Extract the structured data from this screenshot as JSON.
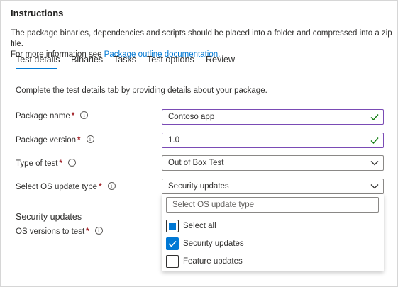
{
  "title": "Instructions",
  "description": {
    "line1": "The package binaries, dependencies and scripts should be placed into a folder and compressed into a zip file.",
    "line2_prefix": "For more information see ",
    "link": "Package outline documentation."
  },
  "tabs": [
    {
      "label": "Test details",
      "active": true
    },
    {
      "label": "Binaries"
    },
    {
      "label": "Tasks"
    },
    {
      "label": "Test options"
    },
    {
      "label": "Review"
    }
  ],
  "intro": "Complete the test details tab by providing details about your package.",
  "fields": {
    "package_name": {
      "label": "Package name",
      "required": "*",
      "value": "Contoso app"
    },
    "package_version": {
      "label": "Package version",
      "required": "*",
      "value": "1.0"
    },
    "type_of_test": {
      "label": "Type of test",
      "required": "*",
      "value": "Out of Box Test"
    },
    "os_update_type": {
      "label": "Select OS update type",
      "required": "*",
      "value": "Security updates"
    }
  },
  "security_section": {
    "title": "Security updates",
    "os_versions_label": "OS versions to test",
    "required": "*"
  },
  "dropdown": {
    "search_placeholder": "Select OS update type",
    "options": [
      {
        "label": "Select all",
        "state": "partial"
      },
      {
        "label": "Security updates",
        "state": "checked"
      },
      {
        "label": "Feature updates",
        "state": "unchecked"
      }
    ]
  },
  "info_glyph": "i",
  "colors": {
    "accent": "#0078d4",
    "required": "#a4262c",
    "valid_border": "#7a4bb5",
    "valid_check": "#107c10"
  }
}
